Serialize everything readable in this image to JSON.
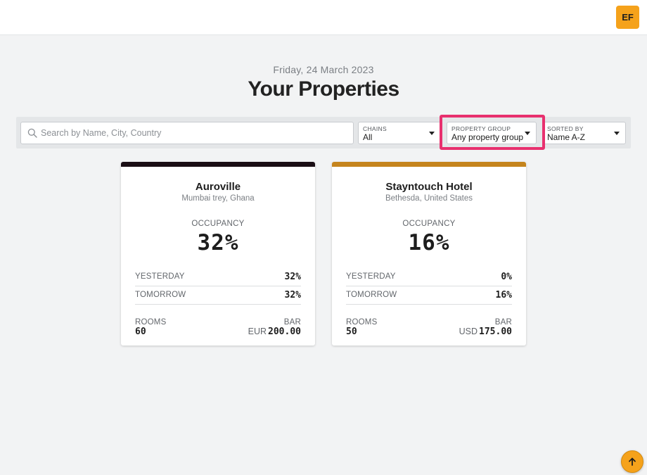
{
  "header": {
    "avatar_initials": "EF",
    "avatar_color": "#f5a21b"
  },
  "page": {
    "date": "Friday, 24 March 2023",
    "title": "Your Properties"
  },
  "filters": {
    "search_placeholder": "Search by Name, City, Country",
    "search_value": "",
    "chains": {
      "label": "CHAINS",
      "value": "All"
    },
    "property_group": {
      "label": "PROPERTY GROUP",
      "value": "Any property group"
    },
    "sorted_by": {
      "label": "SORTED BY",
      "value": "Name A-Z"
    },
    "highlight_color": "#e8306e"
  },
  "properties": [
    {
      "name": "Auroville",
      "location": "Mumbai trey, Ghana",
      "accent_color": "#1a0d14",
      "occupancy_label": "OCCUPANCY",
      "occupancy": "32%",
      "yesterday_label": "YESTERDAY",
      "yesterday": "32%",
      "tomorrow_label": "TOMORROW",
      "tomorrow": "32%",
      "rooms_label": "ROOMS",
      "rooms": "60",
      "bar_label": "BAR",
      "bar_currency": "EUR",
      "bar_amount": "200.00"
    },
    {
      "name": "Stayntouch Hotel",
      "location": "Bethesda, United States",
      "accent_color": "#c5841d",
      "occupancy_label": "OCCUPANCY",
      "occupancy": "16%",
      "yesterday_label": "YESTERDAY",
      "yesterday": "0%",
      "tomorrow_label": "TOMORROW",
      "tomorrow": "16%",
      "rooms_label": "ROOMS",
      "rooms": "50",
      "bar_label": "BAR",
      "bar_currency": "USD",
      "bar_amount": "175.00"
    }
  ],
  "scroll_top": {
    "icon": "arrow-up-icon"
  }
}
